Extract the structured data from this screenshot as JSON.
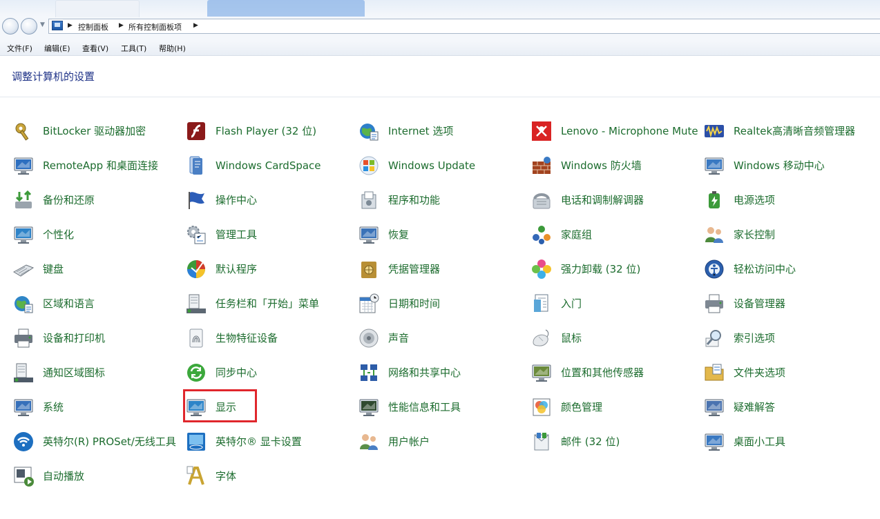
{
  "address": {
    "crumbs": [
      "控制面板",
      "所有控制面板项"
    ]
  },
  "menu": [
    "文件(F)",
    "编辑(E)",
    "查看(V)",
    "工具(T)",
    "帮助(H)"
  ],
  "page_title": "调整计算机的设置",
  "items": [
    {
      "label": "BitLocker 驱动器加密",
      "icon": "bitlocker-key-icon"
    },
    {
      "label": "Flash Player (32 位)",
      "icon": "flash-player-icon"
    },
    {
      "label": "Internet 选项",
      "icon": "internet-options-icon"
    },
    {
      "label": "Lenovo - Microphone Mute",
      "icon": "microphone-mute-icon"
    },
    {
      "label": "Realtek高清晰音频管理器",
      "icon": "realtek-audio-icon"
    },
    {
      "label": "RemoteApp 和桌面连接",
      "icon": "remoteapp-icon"
    },
    {
      "label": "Windows CardSpace",
      "icon": "cardspace-icon"
    },
    {
      "label": "Windows Update",
      "icon": "windows-update-icon"
    },
    {
      "label": "Windows 防火墙",
      "icon": "firewall-icon"
    },
    {
      "label": "Windows 移动中心",
      "icon": "mobility-center-icon"
    },
    {
      "label": "备份和还原",
      "icon": "backup-icon"
    },
    {
      "label": "操作中心",
      "icon": "action-center-flag-icon"
    },
    {
      "label": "程序和功能",
      "icon": "programs-icon"
    },
    {
      "label": "电话和调制解调器",
      "icon": "phone-modem-icon"
    },
    {
      "label": "电源选项",
      "icon": "power-options-icon"
    },
    {
      "label": "个性化",
      "icon": "personalization-icon"
    },
    {
      "label": "管理工具",
      "icon": "admin-tools-icon"
    },
    {
      "label": "恢复",
      "icon": "recovery-icon"
    },
    {
      "label": "家庭组",
      "icon": "homegroup-icon"
    },
    {
      "label": "家长控制",
      "icon": "parental-controls-icon"
    },
    {
      "label": "键盘",
      "icon": "keyboard-icon"
    },
    {
      "label": "默认程序",
      "icon": "default-programs-icon"
    },
    {
      "label": "凭据管理器",
      "icon": "credential-manager-icon"
    },
    {
      "label": "强力卸载 (32 位)",
      "icon": "uninstaller-icon"
    },
    {
      "label": "轻松访问中心",
      "icon": "ease-of-access-icon"
    },
    {
      "label": "区域和语言",
      "icon": "region-language-icon"
    },
    {
      "label": "任务栏和「开始」菜单",
      "icon": "taskbar-icon"
    },
    {
      "label": "日期和时间",
      "icon": "date-time-icon"
    },
    {
      "label": "入门",
      "icon": "getting-started-icon"
    },
    {
      "label": "设备管理器",
      "icon": "device-manager-icon"
    },
    {
      "label": "设备和打印机",
      "icon": "printer-icon"
    },
    {
      "label": "生物特征设备",
      "icon": "fingerprint-icon"
    },
    {
      "label": "声音",
      "icon": "sound-icon"
    },
    {
      "label": "鼠标",
      "icon": "mouse-icon"
    },
    {
      "label": "索引选项",
      "icon": "indexing-icon"
    },
    {
      "label": "通知区域图标",
      "icon": "notification-area-icon"
    },
    {
      "label": "同步中心",
      "icon": "sync-center-icon"
    },
    {
      "label": "网络和共享中心",
      "icon": "network-sharing-icon"
    },
    {
      "label": "位置和其他传感器",
      "icon": "location-sensor-icon"
    },
    {
      "label": "文件夹选项",
      "icon": "folder-options-icon"
    },
    {
      "label": "系统",
      "icon": "system-icon"
    },
    {
      "label": "显示",
      "icon": "display-icon",
      "highlighted": true
    },
    {
      "label": "性能信息和工具",
      "icon": "performance-icon"
    },
    {
      "label": "颜色管理",
      "icon": "color-management-icon"
    },
    {
      "label": "疑难解答",
      "icon": "troubleshooting-icon"
    },
    {
      "label": "英特尔(R) PROSet/无线工具",
      "icon": "intel-wireless-icon"
    },
    {
      "label": "英特尔® 显卡设置",
      "icon": "intel-graphics-icon"
    },
    {
      "label": "用户帐户",
      "icon": "user-accounts-icon"
    },
    {
      "label": "邮件 (32 位)",
      "icon": "mail-icon"
    },
    {
      "label": "桌面小工具",
      "icon": "desktop-gadgets-icon"
    },
    {
      "label": "自动播放",
      "icon": "autoplay-icon"
    },
    {
      "label": "字体",
      "icon": "fonts-icon"
    }
  ],
  "colors": {
    "link_green": "#1c6c2e",
    "title_blue": "#1e3287",
    "highlight_red": "#e0262c"
  }
}
